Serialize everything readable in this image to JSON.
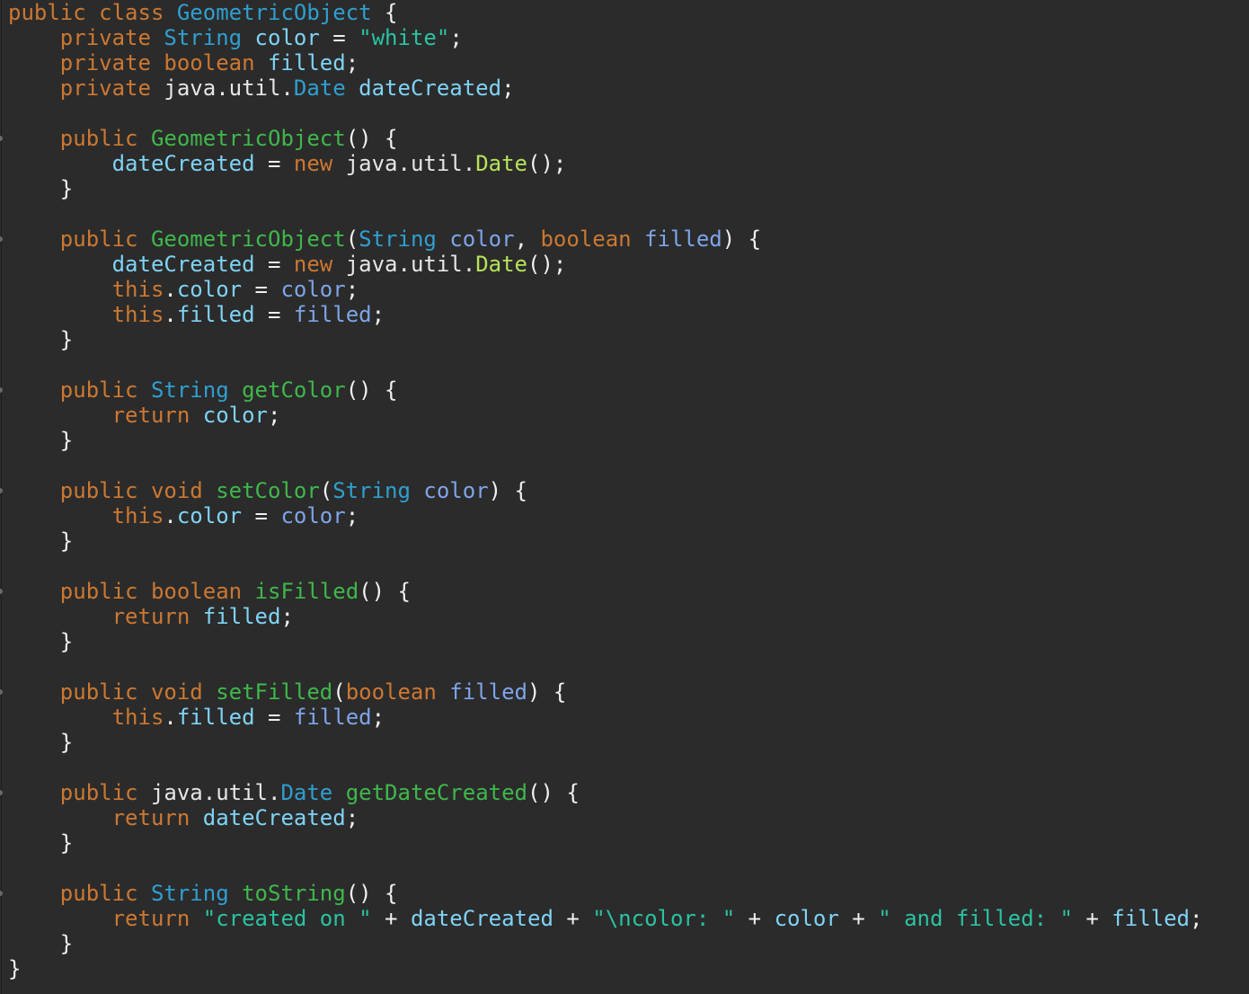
{
  "palette": {
    "background": "#2b2b2b",
    "keyword": "#cc7832",
    "type": "#2f9fd0",
    "field": "#7fd3f5",
    "string": "#2ac3a2",
    "method": "#3fb84b",
    "call": "#b6e35a",
    "parameter": "#7fa4e8",
    "punctuation": "#f0f0f0",
    "plain": "#e6e6e6"
  },
  "code_lines": [
    [
      [
        "kw",
        "public class "
      ],
      [
        "type",
        "GeometricObject"
      ],
      [
        "punct",
        " {"
      ]
    ],
    [
      [
        "plain",
        "    "
      ],
      [
        "kw",
        "private "
      ],
      [
        "type",
        "String "
      ],
      [
        "field",
        "color"
      ],
      [
        "punct",
        " = "
      ],
      [
        "str",
        "\"white\""
      ],
      [
        "punct",
        ";"
      ]
    ],
    [
      [
        "plain",
        "    "
      ],
      [
        "kw",
        "private boolean "
      ],
      [
        "field",
        "filled"
      ],
      [
        "punct",
        ";"
      ]
    ],
    [
      [
        "plain",
        "    "
      ],
      [
        "kw",
        "private "
      ],
      [
        "plain",
        "java.util."
      ],
      [
        "type",
        "Date "
      ],
      [
        "field",
        "dateCreated"
      ],
      [
        "punct",
        ";"
      ]
    ],
    [],
    [
      [
        "plain",
        "    "
      ],
      [
        "kw",
        "public "
      ],
      [
        "method",
        "GeometricObject"
      ],
      [
        "punct",
        "() {"
      ]
    ],
    [
      [
        "plain",
        "        "
      ],
      [
        "field",
        "dateCreated"
      ],
      [
        "punct",
        " = "
      ],
      [
        "kw",
        "new "
      ],
      [
        "plain",
        "java.util."
      ],
      [
        "call",
        "Date"
      ],
      [
        "punct",
        "();"
      ]
    ],
    [
      [
        "plain",
        "    "
      ],
      [
        "punct",
        "}"
      ]
    ],
    [],
    [
      [
        "plain",
        "    "
      ],
      [
        "kw",
        "public "
      ],
      [
        "method",
        "GeometricObject"
      ],
      [
        "punct",
        "("
      ],
      [
        "type",
        "String "
      ],
      [
        "param",
        "color"
      ],
      [
        "punct",
        ", "
      ],
      [
        "kw",
        "boolean "
      ],
      [
        "param",
        "filled"
      ],
      [
        "punct",
        ") {"
      ]
    ],
    [
      [
        "plain",
        "        "
      ],
      [
        "field",
        "dateCreated"
      ],
      [
        "punct",
        " = "
      ],
      [
        "kw",
        "new "
      ],
      [
        "plain",
        "java.util."
      ],
      [
        "call",
        "Date"
      ],
      [
        "punct",
        "();"
      ]
    ],
    [
      [
        "plain",
        "        "
      ],
      [
        "kw",
        "this"
      ],
      [
        "punct",
        "."
      ],
      [
        "field",
        "color"
      ],
      [
        "punct",
        " = "
      ],
      [
        "param",
        "color"
      ],
      [
        "punct",
        ";"
      ]
    ],
    [
      [
        "plain",
        "        "
      ],
      [
        "kw",
        "this"
      ],
      [
        "punct",
        "."
      ],
      [
        "field",
        "filled"
      ],
      [
        "punct",
        " = "
      ],
      [
        "param",
        "filled"
      ],
      [
        "punct",
        ";"
      ]
    ],
    [
      [
        "plain",
        "    "
      ],
      [
        "punct",
        "}"
      ]
    ],
    [],
    [
      [
        "plain",
        "    "
      ],
      [
        "kw",
        "public "
      ],
      [
        "type",
        "String "
      ],
      [
        "method",
        "getColor"
      ],
      [
        "punct",
        "() {"
      ]
    ],
    [
      [
        "plain",
        "        "
      ],
      [
        "kw",
        "return "
      ],
      [
        "field",
        "color"
      ],
      [
        "punct",
        ";"
      ]
    ],
    [
      [
        "plain",
        "    "
      ],
      [
        "punct",
        "}"
      ]
    ],
    [],
    [
      [
        "plain",
        "    "
      ],
      [
        "kw",
        "public void "
      ],
      [
        "method",
        "setColor"
      ],
      [
        "punct",
        "("
      ],
      [
        "type",
        "String "
      ],
      [
        "param",
        "color"
      ],
      [
        "punct",
        ") {"
      ]
    ],
    [
      [
        "plain",
        "        "
      ],
      [
        "kw",
        "this"
      ],
      [
        "punct",
        "."
      ],
      [
        "field",
        "color"
      ],
      [
        "punct",
        " = "
      ],
      [
        "param",
        "color"
      ],
      [
        "punct",
        ";"
      ]
    ],
    [
      [
        "plain",
        "    "
      ],
      [
        "punct",
        "}"
      ]
    ],
    [],
    [
      [
        "plain",
        "    "
      ],
      [
        "kw",
        "public boolean "
      ],
      [
        "method",
        "isFilled"
      ],
      [
        "punct",
        "() {"
      ]
    ],
    [
      [
        "plain",
        "        "
      ],
      [
        "kw",
        "return "
      ],
      [
        "field",
        "filled"
      ],
      [
        "punct",
        ";"
      ]
    ],
    [
      [
        "plain",
        "    "
      ],
      [
        "punct",
        "}"
      ]
    ],
    [],
    [
      [
        "plain",
        "    "
      ],
      [
        "kw",
        "public void "
      ],
      [
        "method",
        "setFilled"
      ],
      [
        "punct",
        "("
      ],
      [
        "kw",
        "boolean "
      ],
      [
        "param",
        "filled"
      ],
      [
        "punct",
        ") {"
      ]
    ],
    [
      [
        "plain",
        "        "
      ],
      [
        "kw",
        "this"
      ],
      [
        "punct",
        "."
      ],
      [
        "field",
        "filled"
      ],
      [
        "punct",
        " = "
      ],
      [
        "param",
        "filled"
      ],
      [
        "punct",
        ";"
      ]
    ],
    [
      [
        "plain",
        "    "
      ],
      [
        "punct",
        "}"
      ]
    ],
    [],
    [
      [
        "plain",
        "    "
      ],
      [
        "kw",
        "public "
      ],
      [
        "plain",
        "java.util."
      ],
      [
        "type",
        "Date "
      ],
      [
        "method",
        "getDateCreated"
      ],
      [
        "punct",
        "() {"
      ]
    ],
    [
      [
        "plain",
        "        "
      ],
      [
        "kw",
        "return "
      ],
      [
        "field",
        "dateCreated"
      ],
      [
        "punct",
        ";"
      ]
    ],
    [
      [
        "plain",
        "    "
      ],
      [
        "punct",
        "}"
      ]
    ],
    [],
    [
      [
        "plain",
        "    "
      ],
      [
        "kw",
        "public "
      ],
      [
        "type",
        "String "
      ],
      [
        "method",
        "toString"
      ],
      [
        "punct",
        "() {"
      ]
    ],
    [
      [
        "plain",
        "        "
      ],
      [
        "kw",
        "return "
      ],
      [
        "str",
        "\"created on \""
      ],
      [
        "punct",
        " + "
      ],
      [
        "field",
        "dateCreated"
      ],
      [
        "punct",
        " + "
      ],
      [
        "str",
        "\"\\ncolor: \""
      ],
      [
        "punct",
        " + "
      ],
      [
        "field",
        "color"
      ],
      [
        "punct",
        " + "
      ],
      [
        "str",
        "\" and filled: \""
      ],
      [
        "punct",
        " + "
      ],
      [
        "field",
        "filled"
      ],
      [
        "punct",
        ";"
      ]
    ],
    [
      [
        "plain",
        "    "
      ],
      [
        "punct",
        "}"
      ]
    ],
    [
      [
        "punct",
        "}"
      ]
    ]
  ]
}
